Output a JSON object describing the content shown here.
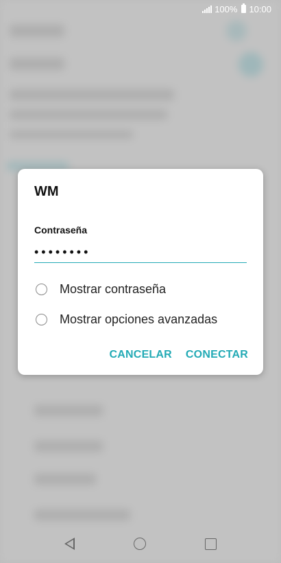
{
  "status_bar": {
    "battery_percent": "100%",
    "time": "10:00"
  },
  "dialog": {
    "title": "WM",
    "password_label": "Contraseña",
    "password_value": "••••••••",
    "options": [
      {
        "label": "Mostrar contraseña",
        "checked": false
      },
      {
        "label": "Mostrar opciones avanzadas",
        "checked": false
      }
    ],
    "cancel_label": "CANCELAR",
    "connect_label": "CONECTAR"
  },
  "colors": {
    "accent": "#22aab5"
  },
  "nav": {
    "back_icon": "back-icon",
    "home_icon": "home-icon",
    "recents_icon": "recents-icon"
  }
}
